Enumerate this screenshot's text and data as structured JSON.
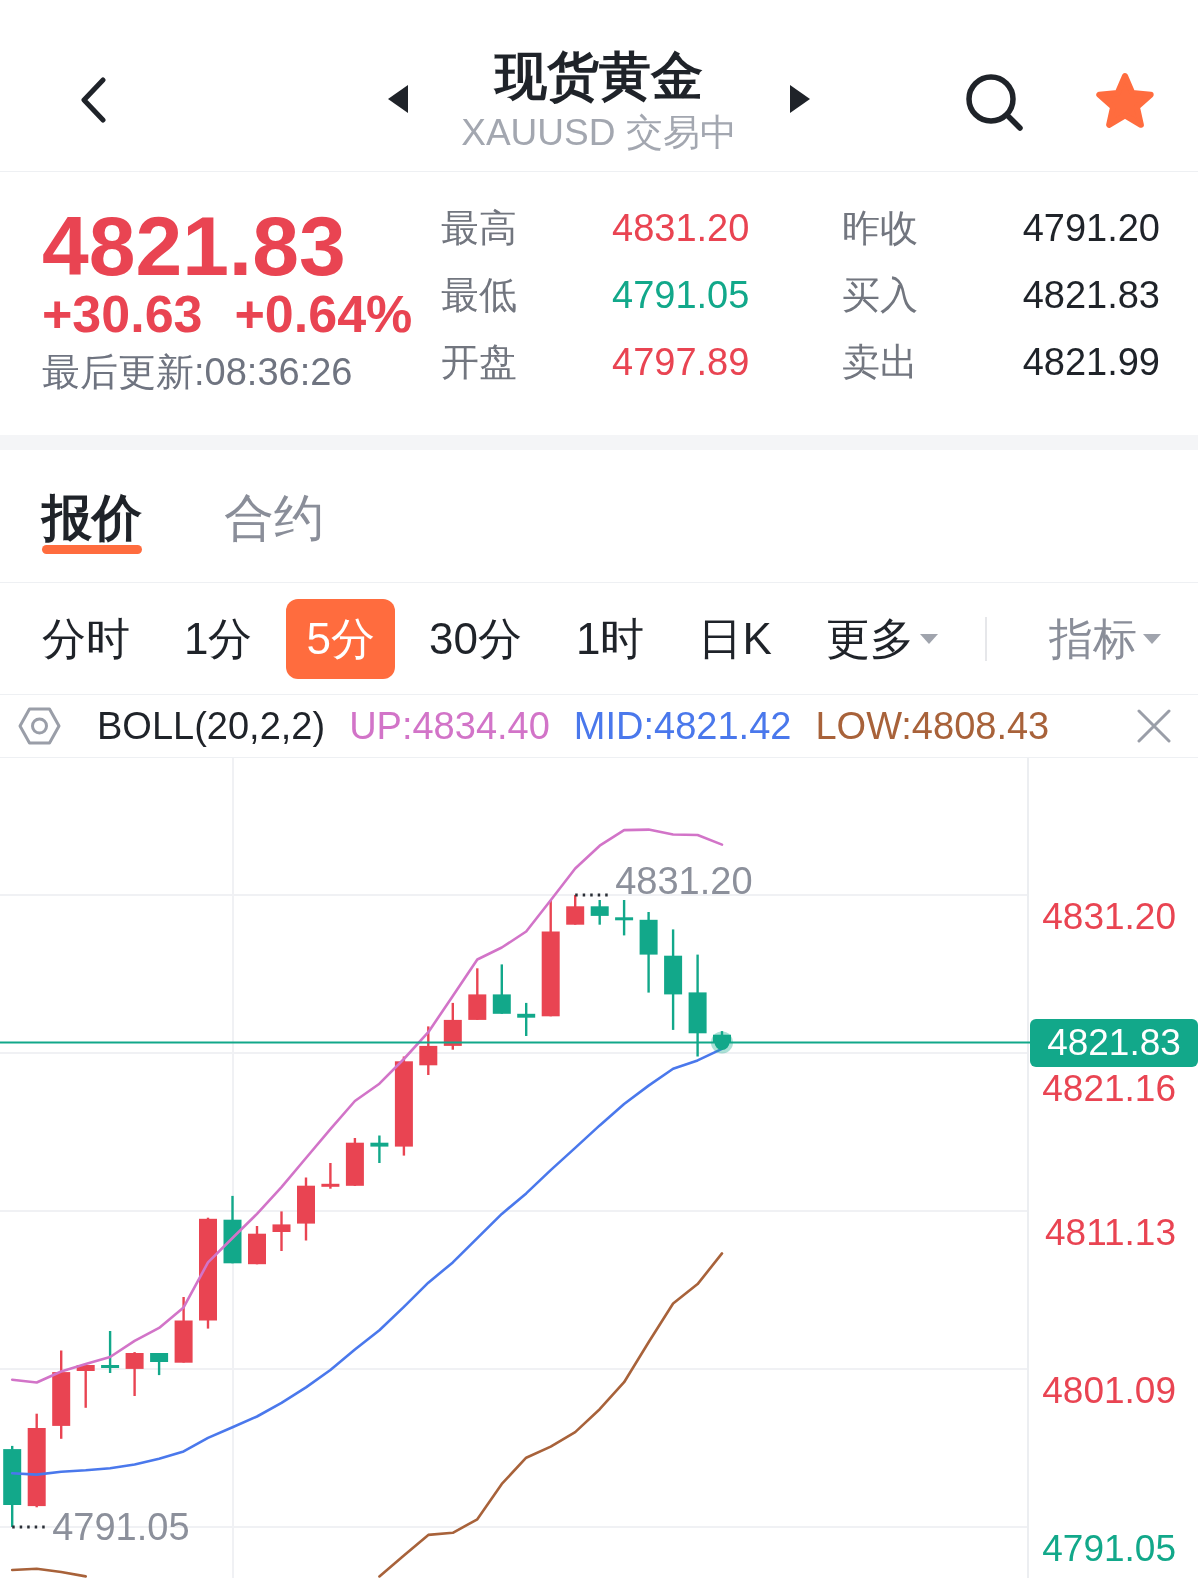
{
  "header": {
    "title": "现货黄金",
    "subtitle": "XAUUSD 交易中",
    "favorite": true
  },
  "quote": {
    "price": "4821.83",
    "change": "+30.63",
    "change_percent": "+0.64%",
    "updated": "最后更新:08:36:26"
  },
  "stats": [
    {
      "label": "最高",
      "value": "4831.20",
      "color": "#e94452"
    },
    {
      "label": "昨收",
      "value": "4791.20",
      "color": "#1f2329"
    },
    {
      "label": "最低",
      "value": "4791.05",
      "color": "#12a88a"
    },
    {
      "label": "买入",
      "value": "4821.83",
      "color": "#1f2329"
    },
    {
      "label": "开盘",
      "value": "4797.89",
      "color": "#e94452"
    },
    {
      "label": "卖出",
      "value": "4821.99",
      "color": "#1f2329"
    }
  ],
  "tabs": [
    {
      "label": "报价",
      "selected": true
    },
    {
      "label": "合约",
      "selected": false
    }
  ],
  "periods": [
    {
      "label": "分时",
      "selected": false,
      "menu": false
    },
    {
      "label": "1分",
      "selected": false,
      "menu": false
    },
    {
      "label": "5分",
      "selected": true,
      "menu": false
    },
    {
      "label": "30分",
      "selected": false,
      "menu": false
    },
    {
      "label": "1时",
      "selected": false,
      "menu": false
    },
    {
      "label": "日K",
      "selected": false,
      "menu": false
    },
    {
      "label": "更多",
      "selected": false,
      "menu": true
    }
  ],
  "indicator_menu": {
    "label": "指标"
  },
  "indicator_bar": {
    "name": "BOLL(20,2,2)",
    "readings": [
      {
        "label": "UP:4834.40",
        "color": "#d274c8"
      },
      {
        "label": "MID:4821.42",
        "color": "#4a78ec"
      },
      {
        "label": "LOW:4808.43",
        "color": "#a8623a"
      }
    ]
  },
  "chart": {
    "chart_data": {
      "type": "line",
      "grid": true,
      "categories": [
        null,
        null,
        null,
        null,
        null,
        null,
        null,
        null,
        null,
        null,
        null,
        null,
        null,
        null,
        null,
        null,
        null,
        null,
        null,
        null,
        null,
        null,
        null,
        null,
        null,
        null,
        null,
        null,
        null,
        null,
        null,
        null,
        null,
        null,
        null,
        null,
        null,
        null,
        null,
        null,
        null,
        null
      ],
      "ylim": [
        4787.81,
        4839.9
      ],
      "yticks": [
        {
          "value": 4831.2,
          "label": "4831.20"
        },
        {
          "value": 4821.16,
          "label": "4821.16"
        },
        {
          "value": 4811.13,
          "label": "4811.13"
        },
        {
          "value": 4801.09,
          "label": "4801.09"
        },
        {
          "value": 4791.05,
          "label": "4791.05"
        }
      ],
      "series": [
        {
          "color": "#d274c8",
          "values": [
            4800.41,
            4800.23,
            4800.93,
            4801.4,
            4801.85,
            4802.87,
            4803.7,
            4805.0,
            4807.86,
            4809.41,
            4810.94,
            4812.64,
            4814.49,
            4816.32,
            4818.11,
            4819.21,
            4820.78,
            4822.48,
            4824.78,
            4827.1,
            4827.86,
            4828.88,
            4830.86,
            4832.88,
            4834.33,
            4835.32,
            4835.35,
            4835.04,
            4835.01,
            4834.4,
            null,
            null,
            null,
            null,
            null,
            null,
            null,
            null,
            null,
            null,
            null,
            null
          ]
        },
        {
          "color": "#4a78ec",
          "values": [
            4794.47,
            4794.38,
            4794.56,
            4794.65,
            4794.78,
            4795.02,
            4795.39,
            4795.85,
            4796.71,
            4797.39,
            4798.07,
            4798.93,
            4799.92,
            4801.02,
            4802.32,
            4803.55,
            4805.03,
            4806.57,
            4807.86,
            4809.4,
            4810.94,
            4812.24,
            4813.72,
            4815.13,
            4816.56,
            4817.92,
            4819.09,
            4820.16,
            4820.69,
            4821.42,
            null,
            null,
            null,
            null,
            null,
            null,
            null,
            null,
            null,
            null,
            null,
            null
          ]
        },
        {
          "color": "#a8623a",
          "values": [
            4788.32,
            4788.4,
            4788.19,
            4787.91,
            null,
            null,
            null,
            null,
            null,
            null,
            null,
            null,
            null,
            null,
            null,
            4787.91,
            4789.23,
            4790.55,
            4790.68,
            4791.54,
            4793.79,
            4795.45,
            4796.16,
            4797.08,
            4798.53,
            4800.25,
            4802.78,
            4805.25,
            4806.48,
            4808.43,
            null,
            null,
            null,
            null,
            null,
            null,
            null,
            null,
            null,
            null,
            null,
            null
          ]
        }
      ],
      "ref_lines": [
        {
          "axis": "y",
          "value": 4821.83,
          "label": "4821.83",
          "color": "#12a88a"
        }
      ],
      "annotations": [
        {
          "text": "4831.20"
        },
        {
          "text": "4791.05"
        }
      ]
    }
  }
}
